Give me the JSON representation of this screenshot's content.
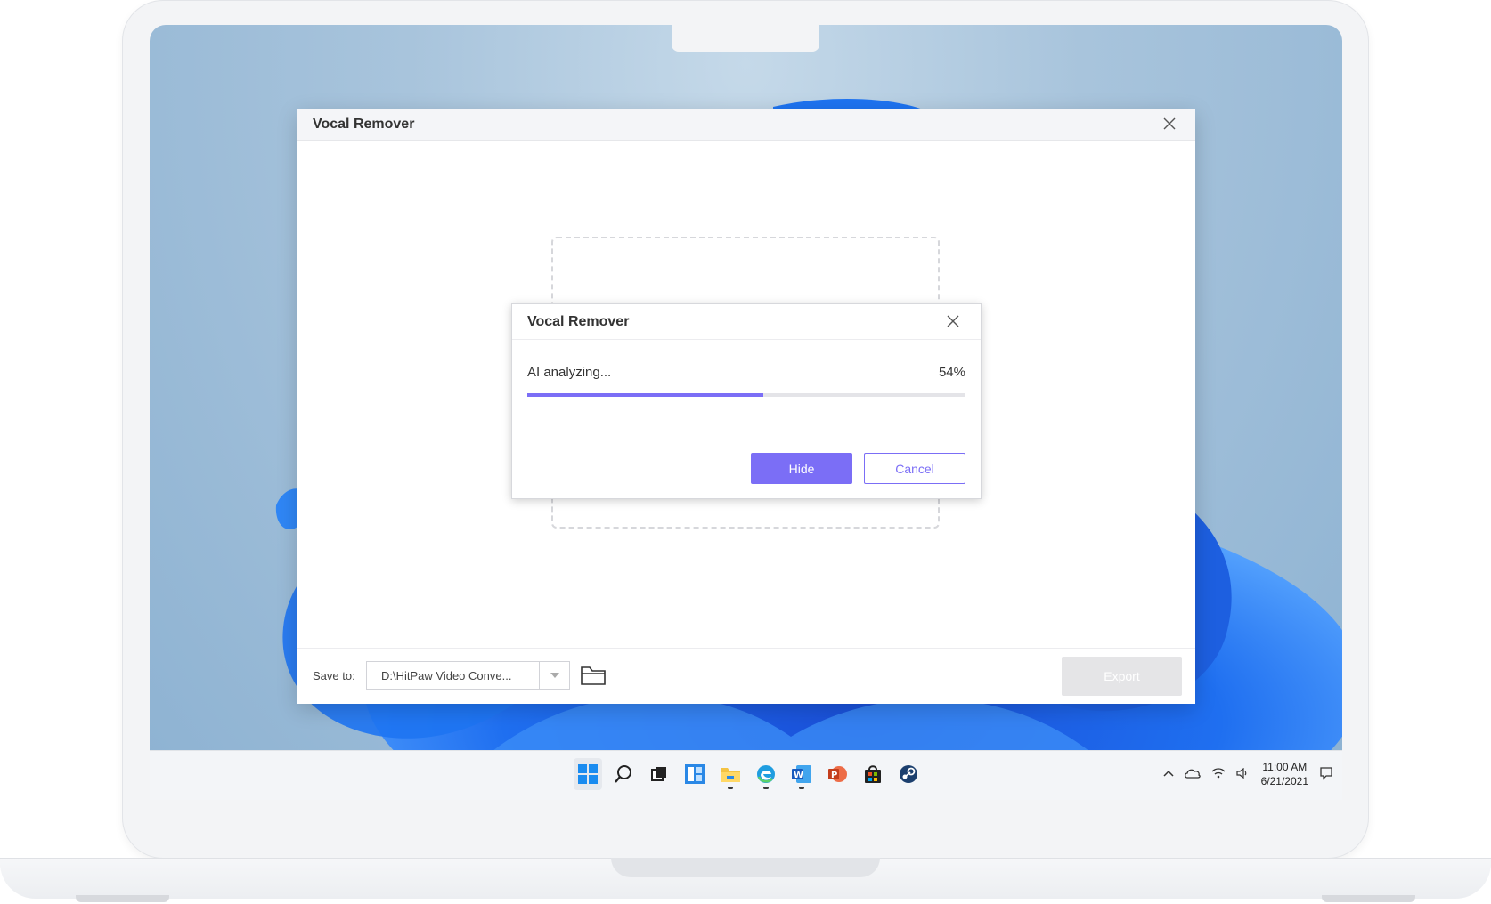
{
  "main_window": {
    "title": "Vocal Remover",
    "save_label": "Save to:",
    "save_path": "D:\\HitPaw Video Conve...",
    "export_label": "Export"
  },
  "dialog": {
    "title": "Vocal Remover",
    "status_text": "AI analyzing...",
    "progress_text": "54%",
    "progress_fraction": 0.54,
    "hide_label": "Hide",
    "cancel_label": "Cancel",
    "accent_color": "#7b6ef6"
  },
  "taskbar": {
    "icons": [
      "windows-start-icon",
      "search-icon",
      "task-view-icon",
      "widgets-icon",
      "file-explorer-icon",
      "edge-icon",
      "word-icon",
      "powerpoint-icon",
      "store-icon",
      "steam-icon"
    ],
    "time": "11:00 AM",
    "date": "6/21/2021"
  }
}
